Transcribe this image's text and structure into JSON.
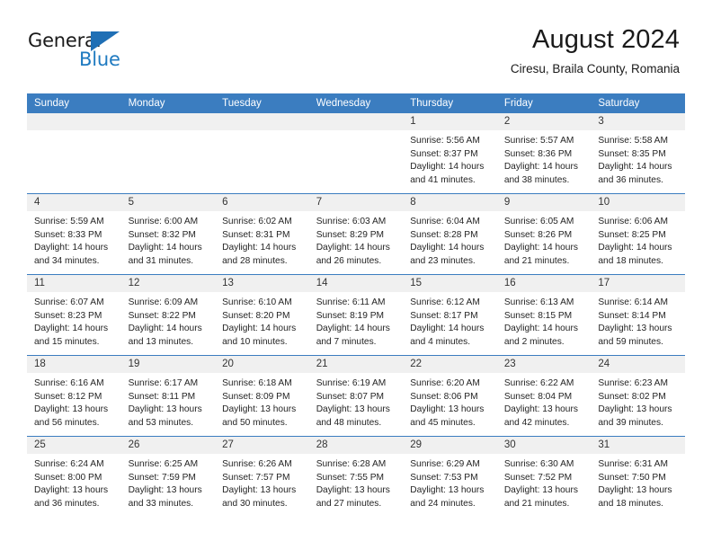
{
  "brand": {
    "name_part1": "General",
    "name_part2": "Blue",
    "mark_color": "#1f6fb5",
    "accent_color": "#1f7ac0"
  },
  "header": {
    "title": "August 2024",
    "subtitle": "Ciresu, Braila County, Romania"
  },
  "theme": {
    "header_row_bg": "#3b7dc0",
    "daynum_bg": "#f0f0f0",
    "grid_line": "#3b7dc0",
    "text": "#242424"
  },
  "weekday_headers": [
    "Sunday",
    "Monday",
    "Tuesday",
    "Wednesday",
    "Thursday",
    "Friday",
    "Saturday"
  ],
  "weeks": [
    [
      {
        "day": "",
        "empty": true,
        "sunrise": "",
        "sunset": "",
        "daylight_line1": "",
        "daylight_line2": ""
      },
      {
        "day": "",
        "empty": true,
        "sunrise": "",
        "sunset": "",
        "daylight_line1": "",
        "daylight_line2": ""
      },
      {
        "day": "",
        "empty": true,
        "sunrise": "",
        "sunset": "",
        "daylight_line1": "",
        "daylight_line2": ""
      },
      {
        "day": "",
        "empty": true,
        "sunrise": "",
        "sunset": "",
        "daylight_line1": "",
        "daylight_line2": ""
      },
      {
        "day": "1",
        "empty": false,
        "sunrise": "Sunrise: 5:56 AM",
        "sunset": "Sunset: 8:37 PM",
        "daylight_line1": "Daylight: 14 hours",
        "daylight_line2": "and 41 minutes."
      },
      {
        "day": "2",
        "empty": false,
        "sunrise": "Sunrise: 5:57 AM",
        "sunset": "Sunset: 8:36 PM",
        "daylight_line1": "Daylight: 14 hours",
        "daylight_line2": "and 38 minutes."
      },
      {
        "day": "3",
        "empty": false,
        "sunrise": "Sunrise: 5:58 AM",
        "sunset": "Sunset: 8:35 PM",
        "daylight_line1": "Daylight: 14 hours",
        "daylight_line2": "and 36 minutes."
      }
    ],
    [
      {
        "day": "4",
        "empty": false,
        "sunrise": "Sunrise: 5:59 AM",
        "sunset": "Sunset: 8:33 PM",
        "daylight_line1": "Daylight: 14 hours",
        "daylight_line2": "and 34 minutes."
      },
      {
        "day": "5",
        "empty": false,
        "sunrise": "Sunrise: 6:00 AM",
        "sunset": "Sunset: 8:32 PM",
        "daylight_line1": "Daylight: 14 hours",
        "daylight_line2": "and 31 minutes."
      },
      {
        "day": "6",
        "empty": false,
        "sunrise": "Sunrise: 6:02 AM",
        "sunset": "Sunset: 8:31 PM",
        "daylight_line1": "Daylight: 14 hours",
        "daylight_line2": "and 28 minutes."
      },
      {
        "day": "7",
        "empty": false,
        "sunrise": "Sunrise: 6:03 AM",
        "sunset": "Sunset: 8:29 PM",
        "daylight_line1": "Daylight: 14 hours",
        "daylight_line2": "and 26 minutes."
      },
      {
        "day": "8",
        "empty": false,
        "sunrise": "Sunrise: 6:04 AM",
        "sunset": "Sunset: 8:28 PM",
        "daylight_line1": "Daylight: 14 hours",
        "daylight_line2": "and 23 minutes."
      },
      {
        "day": "9",
        "empty": false,
        "sunrise": "Sunrise: 6:05 AM",
        "sunset": "Sunset: 8:26 PM",
        "daylight_line1": "Daylight: 14 hours",
        "daylight_line2": "and 21 minutes."
      },
      {
        "day": "10",
        "empty": false,
        "sunrise": "Sunrise: 6:06 AM",
        "sunset": "Sunset: 8:25 PM",
        "daylight_line1": "Daylight: 14 hours",
        "daylight_line2": "and 18 minutes."
      }
    ],
    [
      {
        "day": "11",
        "empty": false,
        "sunrise": "Sunrise: 6:07 AM",
        "sunset": "Sunset: 8:23 PM",
        "daylight_line1": "Daylight: 14 hours",
        "daylight_line2": "and 15 minutes."
      },
      {
        "day": "12",
        "empty": false,
        "sunrise": "Sunrise: 6:09 AM",
        "sunset": "Sunset: 8:22 PM",
        "daylight_line1": "Daylight: 14 hours",
        "daylight_line2": "and 13 minutes."
      },
      {
        "day": "13",
        "empty": false,
        "sunrise": "Sunrise: 6:10 AM",
        "sunset": "Sunset: 8:20 PM",
        "daylight_line1": "Daylight: 14 hours",
        "daylight_line2": "and 10 minutes."
      },
      {
        "day": "14",
        "empty": false,
        "sunrise": "Sunrise: 6:11 AM",
        "sunset": "Sunset: 8:19 PM",
        "daylight_line1": "Daylight: 14 hours",
        "daylight_line2": "and 7 minutes."
      },
      {
        "day": "15",
        "empty": false,
        "sunrise": "Sunrise: 6:12 AM",
        "sunset": "Sunset: 8:17 PM",
        "daylight_line1": "Daylight: 14 hours",
        "daylight_line2": "and 4 minutes."
      },
      {
        "day": "16",
        "empty": false,
        "sunrise": "Sunrise: 6:13 AM",
        "sunset": "Sunset: 8:15 PM",
        "daylight_line1": "Daylight: 14 hours",
        "daylight_line2": "and 2 minutes."
      },
      {
        "day": "17",
        "empty": false,
        "sunrise": "Sunrise: 6:14 AM",
        "sunset": "Sunset: 8:14 PM",
        "daylight_line1": "Daylight: 13 hours",
        "daylight_line2": "and 59 minutes."
      }
    ],
    [
      {
        "day": "18",
        "empty": false,
        "sunrise": "Sunrise: 6:16 AM",
        "sunset": "Sunset: 8:12 PM",
        "daylight_line1": "Daylight: 13 hours",
        "daylight_line2": "and 56 minutes."
      },
      {
        "day": "19",
        "empty": false,
        "sunrise": "Sunrise: 6:17 AM",
        "sunset": "Sunset: 8:11 PM",
        "daylight_line1": "Daylight: 13 hours",
        "daylight_line2": "and 53 minutes."
      },
      {
        "day": "20",
        "empty": false,
        "sunrise": "Sunrise: 6:18 AM",
        "sunset": "Sunset: 8:09 PM",
        "daylight_line1": "Daylight: 13 hours",
        "daylight_line2": "and 50 minutes."
      },
      {
        "day": "21",
        "empty": false,
        "sunrise": "Sunrise: 6:19 AM",
        "sunset": "Sunset: 8:07 PM",
        "daylight_line1": "Daylight: 13 hours",
        "daylight_line2": "and 48 minutes."
      },
      {
        "day": "22",
        "empty": false,
        "sunrise": "Sunrise: 6:20 AM",
        "sunset": "Sunset: 8:06 PM",
        "daylight_line1": "Daylight: 13 hours",
        "daylight_line2": "and 45 minutes."
      },
      {
        "day": "23",
        "empty": false,
        "sunrise": "Sunrise: 6:22 AM",
        "sunset": "Sunset: 8:04 PM",
        "daylight_line1": "Daylight: 13 hours",
        "daylight_line2": "and 42 minutes."
      },
      {
        "day": "24",
        "empty": false,
        "sunrise": "Sunrise: 6:23 AM",
        "sunset": "Sunset: 8:02 PM",
        "daylight_line1": "Daylight: 13 hours",
        "daylight_line2": "and 39 minutes."
      }
    ],
    [
      {
        "day": "25",
        "empty": false,
        "sunrise": "Sunrise: 6:24 AM",
        "sunset": "Sunset: 8:00 PM",
        "daylight_line1": "Daylight: 13 hours",
        "daylight_line2": "and 36 minutes."
      },
      {
        "day": "26",
        "empty": false,
        "sunrise": "Sunrise: 6:25 AM",
        "sunset": "Sunset: 7:59 PM",
        "daylight_line1": "Daylight: 13 hours",
        "daylight_line2": "and 33 minutes."
      },
      {
        "day": "27",
        "empty": false,
        "sunrise": "Sunrise: 6:26 AM",
        "sunset": "Sunset: 7:57 PM",
        "daylight_line1": "Daylight: 13 hours",
        "daylight_line2": "and 30 minutes."
      },
      {
        "day": "28",
        "empty": false,
        "sunrise": "Sunrise: 6:28 AM",
        "sunset": "Sunset: 7:55 PM",
        "daylight_line1": "Daylight: 13 hours",
        "daylight_line2": "and 27 minutes."
      },
      {
        "day": "29",
        "empty": false,
        "sunrise": "Sunrise: 6:29 AM",
        "sunset": "Sunset: 7:53 PM",
        "daylight_line1": "Daylight: 13 hours",
        "daylight_line2": "and 24 minutes."
      },
      {
        "day": "30",
        "empty": false,
        "sunrise": "Sunrise: 6:30 AM",
        "sunset": "Sunset: 7:52 PM",
        "daylight_line1": "Daylight: 13 hours",
        "daylight_line2": "and 21 minutes."
      },
      {
        "day": "31",
        "empty": false,
        "sunrise": "Sunrise: 6:31 AM",
        "sunset": "Sunset: 7:50 PM",
        "daylight_line1": "Daylight: 13 hours",
        "daylight_line2": "and 18 minutes."
      }
    ]
  ]
}
